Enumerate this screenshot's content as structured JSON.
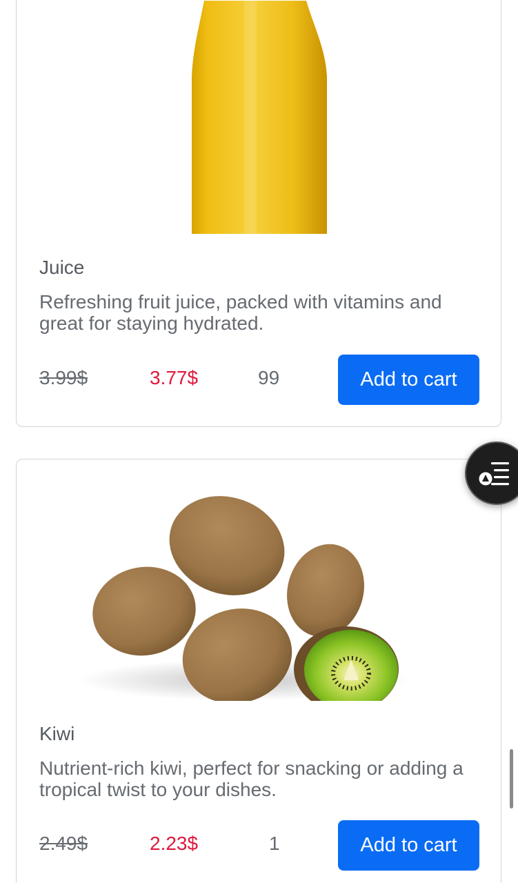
{
  "products": [
    {
      "name": "Juice",
      "description": "Refreshing fruit juice, packed with vitamins and great for staying hydrated.",
      "old_price": "3.99$",
      "price": "3.77$",
      "quantity": "99",
      "button_label": "Add to cart",
      "image": "juice-bottle-image"
    },
    {
      "name": "Kiwi",
      "description": "Nutrient-rich kiwi, perfect for snacking or adding a tropical twist to your dishes.",
      "old_price": "2.49$",
      "price": "2.23$",
      "quantity": "1",
      "button_label": "Add to cart",
      "image": "kiwi-fruit-image"
    }
  ],
  "floating_button": {
    "icon": "list-filter-icon"
  },
  "colors": {
    "accent": "#0a6cf5",
    "sale_price": "#e0173d",
    "text": "#666b71"
  }
}
